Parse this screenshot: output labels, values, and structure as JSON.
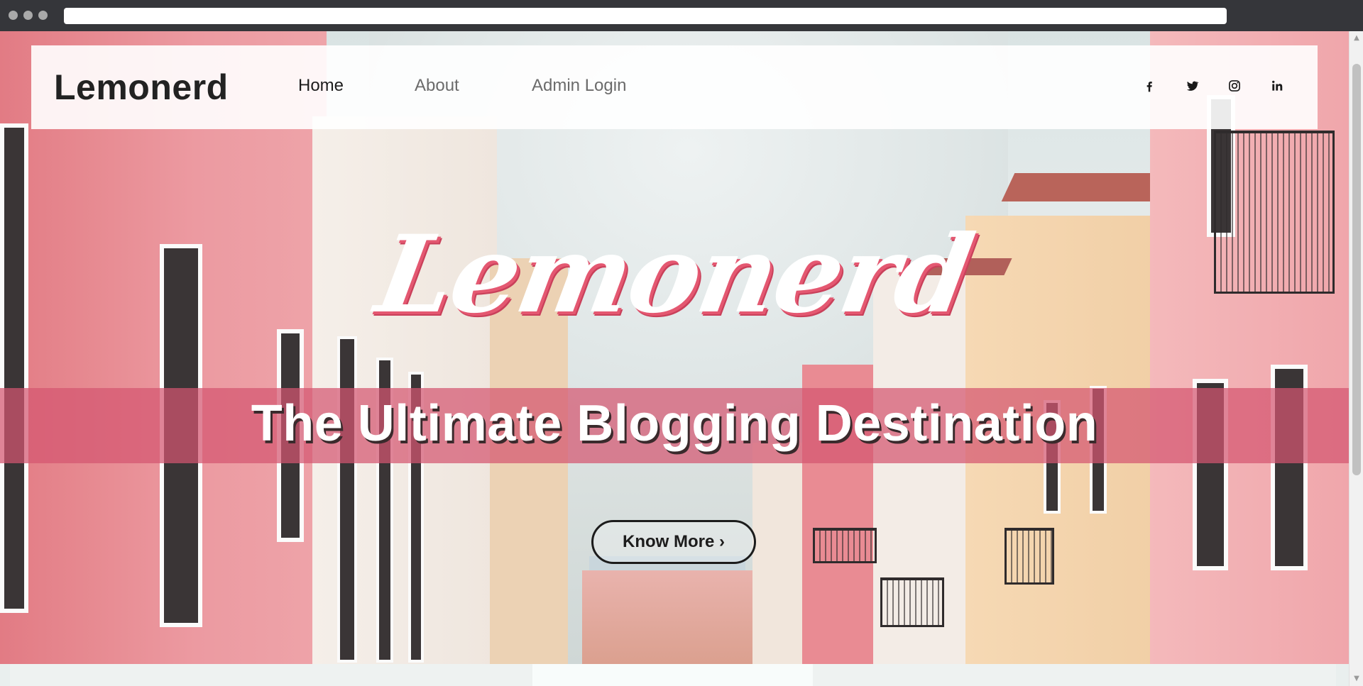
{
  "browser": {
    "window_controls": [
      "close",
      "minimize",
      "maximize"
    ],
    "address_value": ""
  },
  "navbar": {
    "brand": "Lemonerd",
    "links": [
      {
        "label": "Home",
        "active": true
      },
      {
        "label": "About",
        "active": false
      },
      {
        "label": "Admin Login",
        "active": false
      }
    ],
    "social_icons": [
      "facebook-icon",
      "twitter-icon",
      "instagram-icon",
      "linkedin-icon"
    ]
  },
  "hero": {
    "script_logo": "Lemonerd",
    "headline": "The Ultimate Blogging Destination",
    "cta_label": "Know More ›",
    "banner_color": "#d45670",
    "logo_shadow_color": "#e45871"
  },
  "colors": {
    "navbar_bg": "#ffffff",
    "text_dark": "#1d1d1d",
    "text_muted": "#6b6b6b",
    "chrome_bg": "#35363a"
  }
}
